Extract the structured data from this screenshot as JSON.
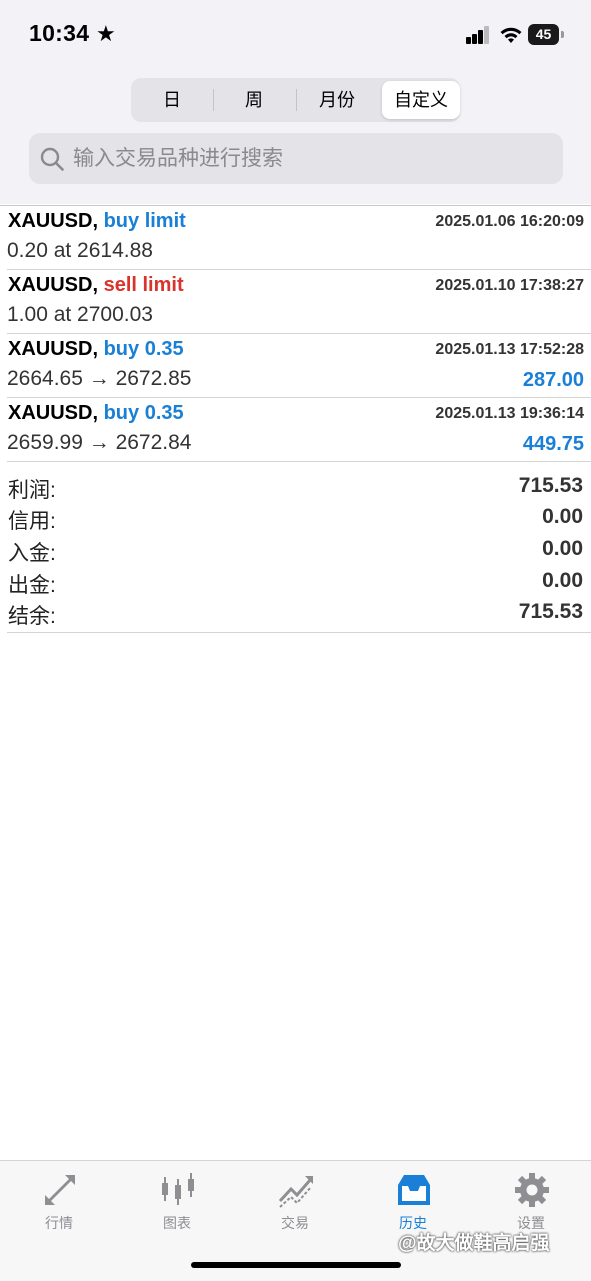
{
  "status_bar": {
    "time": "10:34",
    "battery": "45"
  },
  "segments": [
    {
      "label": "日",
      "active": false
    },
    {
      "label": "周",
      "active": false
    },
    {
      "label": "月份",
      "active": false
    },
    {
      "label": "自定义",
      "active": true
    }
  ],
  "search": {
    "placeholder": "输入交易品种进行搜索",
    "value": ""
  },
  "orders": [
    {
      "symbol": "XAUUSD,",
      "action": "buy limit",
      "action_color": "blue",
      "time": "2025.01.06 16:20:09",
      "detail": "0.20 at 2614.88",
      "profit": ""
    },
    {
      "symbol": "XAUUSD,",
      "action": "sell limit",
      "action_color": "red",
      "time": "2025.01.10 17:38:27",
      "detail": "1.00 at 2700.03",
      "profit": ""
    },
    {
      "symbol": "XAUUSD,",
      "action": "buy 0.35",
      "action_color": "blue",
      "time": "2025.01.13 17:52:28",
      "detail": "2664.65 → 2672.85",
      "profit": "287.00"
    },
    {
      "symbol": "XAUUSD,",
      "action": "buy 0.35",
      "action_color": "blue",
      "time": "2025.01.13 19:36:14",
      "detail": "2659.99 → 2672.84",
      "profit": "449.75"
    }
  ],
  "summary": [
    {
      "label": "利润:",
      "value": "715.53"
    },
    {
      "label": "信用:",
      "value": "0.00"
    },
    {
      "label": "入金:",
      "value": "0.00"
    },
    {
      "label": "出金:",
      "value": "0.00"
    },
    {
      "label": "结余:",
      "value": "715.53"
    }
  ],
  "tabs": [
    {
      "label": "行情",
      "icon": "quotes-arrows-icon",
      "active": false
    },
    {
      "label": "图表",
      "icon": "candlestick-chart-icon",
      "active": false
    },
    {
      "label": "交易",
      "icon": "trade-trend-icon",
      "active": false
    },
    {
      "label": "历史",
      "icon": "history-inbox-icon",
      "active": true
    },
    {
      "label": "设置",
      "icon": "gear-icon",
      "active": false
    }
  ],
  "watermark": "@故大做鞋高启强",
  "colors": {
    "blue": "#1a7fd6",
    "red": "#d9332b",
    "inactive_tab": "#8e8e93"
  }
}
